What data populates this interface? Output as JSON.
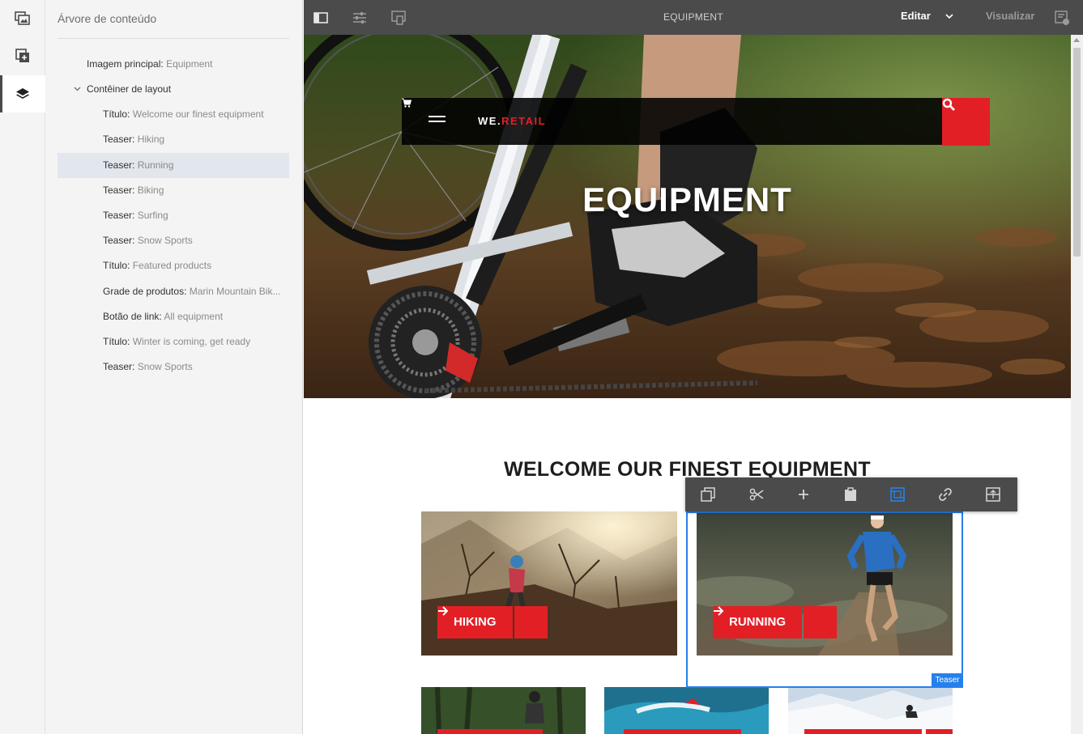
{
  "rail": {
    "items": [
      {
        "icon": "side-panel-assets-icon"
      },
      {
        "icon": "components-icon"
      },
      {
        "icon": "content-tree-icon"
      }
    ]
  },
  "tree": {
    "title": "Árvore de conteúdo",
    "rows": [
      {
        "key": "Imagem principal:",
        "value": "Equipment"
      },
      {
        "key": "Contêiner de layout",
        "value": ""
      },
      {
        "key": "Título:",
        "value": "Welcome our finest equipment"
      },
      {
        "key": "Teaser:",
        "value": "Hiking"
      },
      {
        "key": "Teaser:",
        "value": "Running"
      },
      {
        "key": "Teaser:",
        "value": "Biking"
      },
      {
        "key": "Teaser:",
        "value": "Surfing"
      },
      {
        "key": "Teaser:",
        "value": "Snow Sports"
      },
      {
        "key": "Título:",
        "value": "Featured products"
      },
      {
        "key": "Grade de produtos:",
        "value": "Marin Mountain Bik..."
      },
      {
        "key": "Botão de link:",
        "value": "All equipment"
      },
      {
        "key": "Título:",
        "value": "Winter is coming, get ready"
      },
      {
        "key": "Teaser:",
        "value": "Snow Sports"
      }
    ],
    "selected_index": 4
  },
  "topbar": {
    "page_name": "EQUIPMENT",
    "mode": "Editar",
    "preview": "Visualizar"
  },
  "site": {
    "logo_we": "WE.",
    "logo_retail": "RETAIL",
    "hero_title": "EQUIPMENT",
    "section_title": "WELCOME OUR FINEST EQUIPMENT"
  },
  "teasers": {
    "hiking": "HIKING",
    "running": "RUNNING"
  },
  "selection": {
    "tag": "Teaser"
  },
  "colors": {
    "brand_red": "#e31f26",
    "selection_blue": "#2680eb",
    "toolbar_dark": "#4b4b4b"
  }
}
